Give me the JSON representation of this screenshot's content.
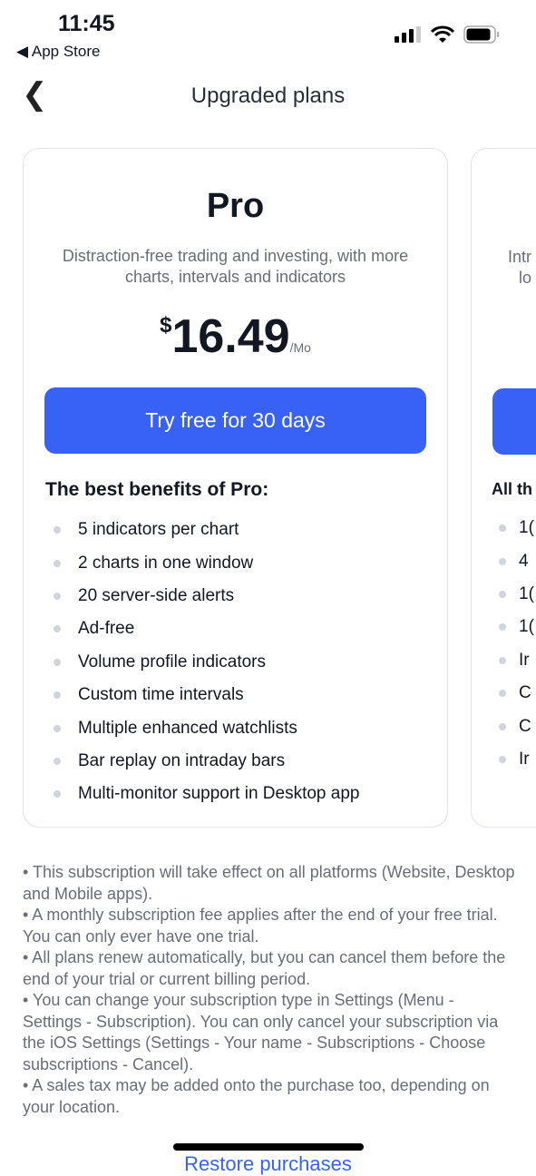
{
  "status_bar": {
    "time": "11:45",
    "back_app": "◀ App Store"
  },
  "nav": {
    "title": "Upgraded plans"
  },
  "plans": [
    {
      "name": "Pro",
      "description": "Distraction-free trading and investing, with more charts, intervals and indicators",
      "currency": "$",
      "price": "16.49",
      "period": "/Mo",
      "cta": "Try free for 30 days",
      "benefits_title": "The best benefits of Pro:",
      "benefits": [
        "5 indicators per chart",
        "2 charts in one window",
        "20 server-side alerts",
        "Ad-free",
        "Volume profile indicators",
        "Custom time intervals",
        "Multiple enhanced watchlists",
        "Bar replay on intraday bars",
        "Multi-monitor support in Desktop app"
      ]
    },
    {
      "description_fragment_1": "Intr",
      "description_fragment_2": "lo",
      "benefits_title_fragment": "All th",
      "benefit_fragments": [
        "1(",
        "4",
        "1(",
        "1(",
        "Ir",
        "C",
        "C",
        "Ir"
      ]
    }
  ],
  "notes": [
    "• This subscription will take effect on all platforms (Website, Desktop and Mobile apps).",
    "• A monthly subscription fee applies after the end of your free trial. You can only ever have one trial.",
    "• All plans renew automatically, but you can cancel them before the end of your trial or current billing period.",
    "• You can change your subscription type in Settings (Menu - Settings - Subscription). You can only cancel your subscription via the iOS Settings (Settings - Your name - Subscriptions - Choose subscriptions - Cancel).",
    "• A sales tax may be added onto the purchase too, depending on your location."
  ],
  "restore": "Restore purchases",
  "colors": {
    "accent": "#3862f5"
  }
}
